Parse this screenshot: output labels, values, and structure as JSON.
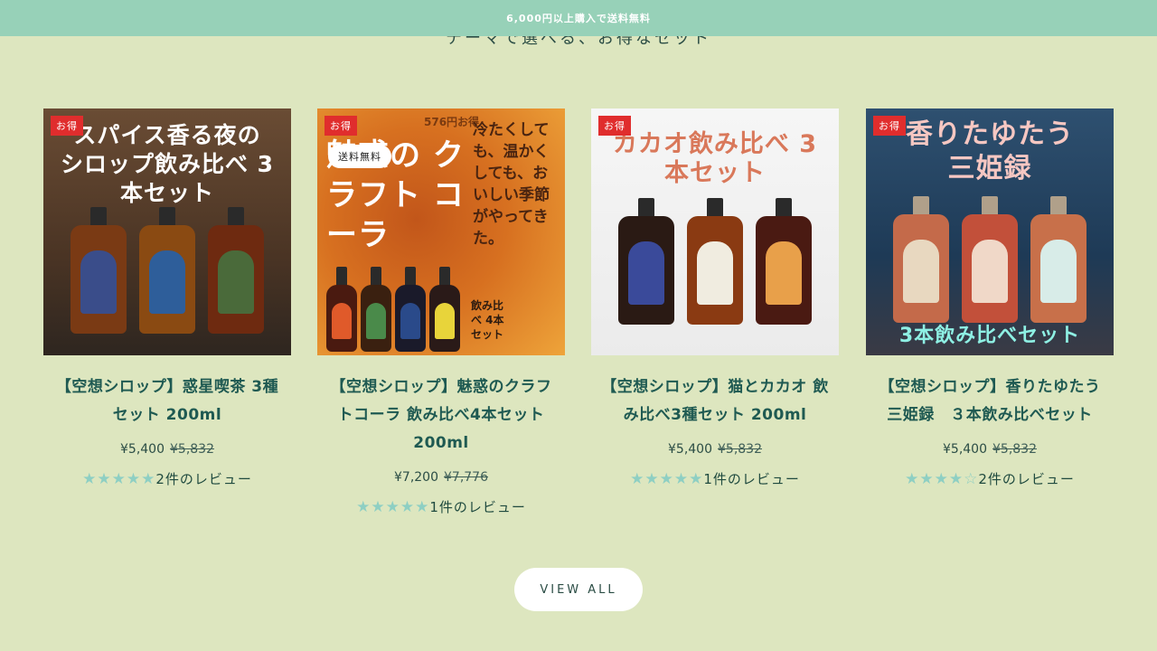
{
  "announcement": "6,000円以上購入で送料無料",
  "section_heading": "テーマで選べる、お得なセット",
  "products": [
    {
      "badge": "お得",
      "shipping_badge": "",
      "image_text": "スパイス香る夜の シロップ飲み比べ 3本セット",
      "title": "【空想シロップ】惑星喫茶 3種セット 200ml",
      "price": "¥5,400",
      "compare_price": "¥5,832",
      "stars": "★★★★★",
      "reviews": "2件のレビュー",
      "bg": "#5a4030",
      "bottle_colors": [
        "#7a3a14",
        "#8a4a12",
        "#6e2a10"
      ],
      "label_colors": [
        "#3a4d8a",
        "#2e5e9a",
        "#4a6a3a"
      ]
    },
    {
      "badge": "お得",
      "shipping_badge": "送料無料",
      "image_text": "魅惑の クラフト コーラ",
      "title": "【空想シロップ】魅惑のクラフトコーラ 飲み比べ4本セット 200ml",
      "price": "¥7,200",
      "compare_price": "¥7,776",
      "stars": "★★★★★",
      "reviews": "1件のレビュー",
      "bg": "#e0872a",
      "bottle_colors": [
        "#4a1a10",
        "#3a2010",
        "#1a1a2a",
        "#2a1a18"
      ],
      "label_colors": [
        "#e05a2a",
        "#4a8a4a",
        "#2a4a8a",
        "#e8d43a"
      ]
    },
    {
      "badge": "お得",
      "shipping_badge": "",
      "image_text": "カカオ飲み比べ 3本セット",
      "title": "【空想シロップ】猫とカカオ 飲み比べ3種セット 200ml",
      "price": "¥5,400",
      "compare_price": "¥5,832",
      "stars": "★★★★★",
      "reviews": "1件のレビュー",
      "bg": "#f1f1f1",
      "bottle_colors": [
        "#2a1a14",
        "#8a3a12",
        "#4a1a12"
      ],
      "label_colors": [
        "#3a4a9a",
        "#f0ece0",
        "#e8a04a"
      ]
    },
    {
      "badge": "お得",
      "shipping_badge": "",
      "image_text": "香りたゆたう 三姫録",
      "title": "【空想シロップ】香りたゆたう三姫録　３本飲み比べセット",
      "price": "¥5,400",
      "compare_price": "¥5,832",
      "stars": "★★★★☆",
      "reviews": "2件のレビュー",
      "bg": "#2a4a6a",
      "bottle_colors": [
        "#c46a4a",
        "#c2503a",
        "#c8704a"
      ],
      "label_colors": [
        "#e8d8c0",
        "#f0d8c8",
        "#d8ece8"
      ]
    }
  ],
  "view_all_label": "VIEW ALL",
  "image_bottom_text": "3本飲み比べセット",
  "price_tag": "576円お得",
  "cola_side_text": "冷たくしても、温かくしても、おいしい季節がやってきた。",
  "cola_count_text": "飲み比べ 4本 セット"
}
